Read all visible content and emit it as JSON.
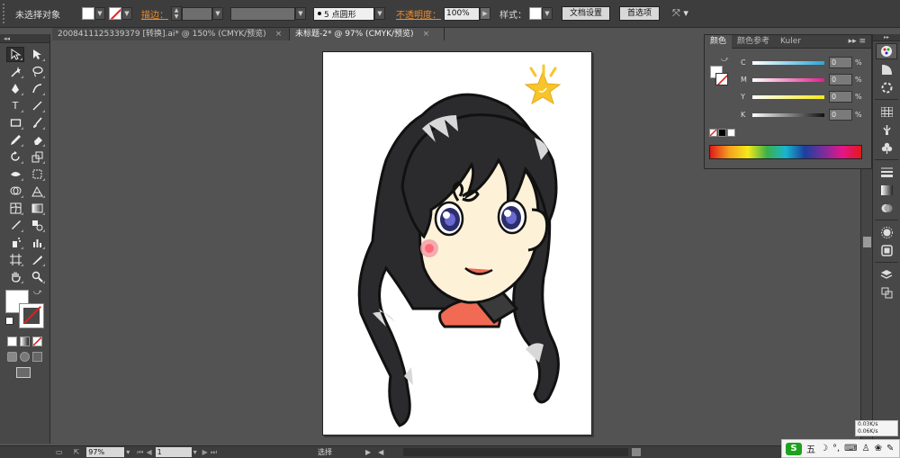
{
  "control_bar": {
    "selection_label": "未选择对象",
    "stroke_label": "描边：",
    "brush_label": "5 点圆形",
    "opacity_label": "不透明度：",
    "opacity_value": "100%",
    "style_label": "样式：",
    "doc_setup_button": "文档设置",
    "preferences_button": "首选项"
  },
  "tabs": [
    {
      "label": "2008411125339379 [转换].ai* @ 150% (CMYK/预览)",
      "close": "×"
    },
    {
      "label": "未标题-2* @ 97% (CMYK/预览)",
      "close": "×"
    }
  ],
  "color_panel": {
    "tabs": [
      "颜色",
      "颜色参考",
      "Kuler"
    ],
    "menu_glyph": "▸▸ ≡",
    "channels": [
      {
        "label": "C",
        "value": "0",
        "unit": "%",
        "gradient": "#2aa7d9"
      },
      {
        "label": "M",
        "value": "0",
        "unit": "%",
        "gradient": "#e21d8d"
      },
      {
        "label": "Y",
        "value": "0",
        "unit": "%",
        "gradient": "#f4e81b"
      },
      {
        "label": "K",
        "value": "0",
        "unit": "%",
        "gradient": "#111111"
      }
    ]
  },
  "status_bar": {
    "zoom": "97%",
    "page": "1",
    "status_text": "选择"
  },
  "ime": {
    "logo": "S",
    "mode": "五"
  },
  "net_speed": {
    "up": "0.03K/s",
    "down": "0.06K/s"
  },
  "colors": {
    "accent_orange": "#f08c2a",
    "hair": "#2b2b2d",
    "skin": "#fdf1d8",
    "shirt": "#f06a54",
    "star": "#f7c52b"
  }
}
